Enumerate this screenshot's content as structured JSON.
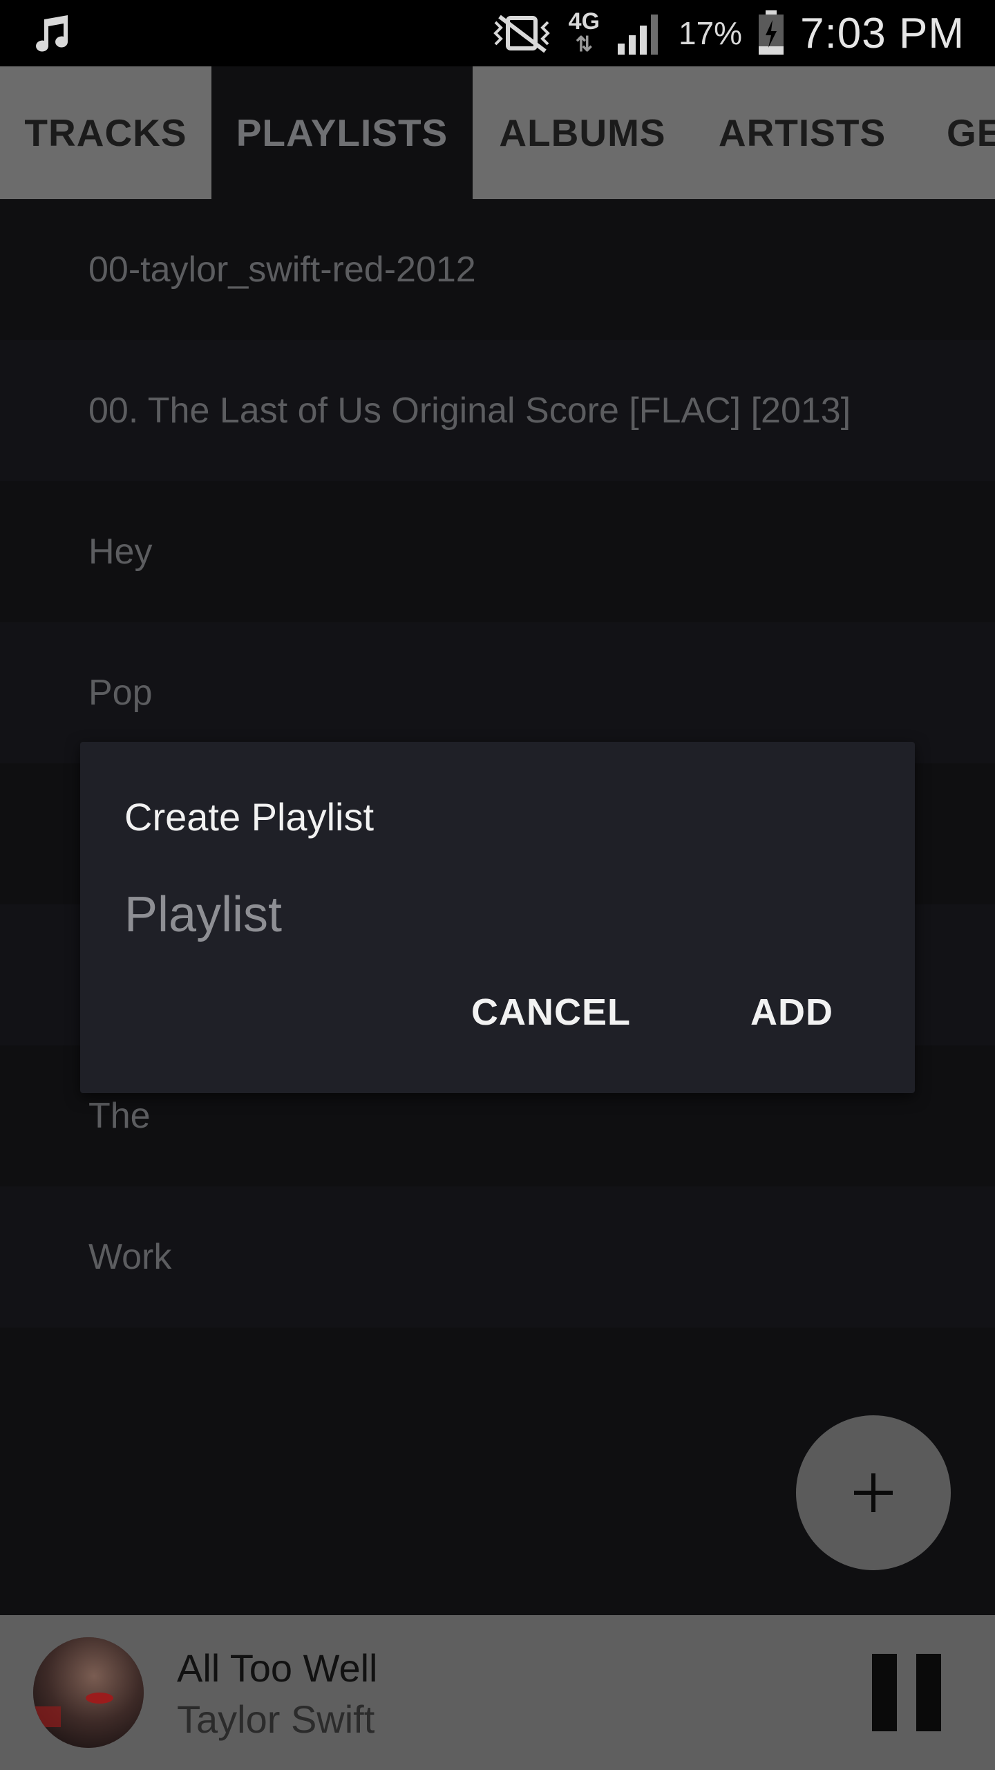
{
  "status_bar": {
    "network": "4G",
    "battery": "17%",
    "time": "7:03 PM",
    "icons": [
      "music-note-icon",
      "vibrate-mute-icon",
      "data-arrows-icon",
      "signal-icon",
      "battery-charging-icon"
    ]
  },
  "tabs": [
    {
      "label": "TRACKS",
      "active": false
    },
    {
      "label": "PLAYLISTS",
      "active": true
    },
    {
      "label": "ALBUMS",
      "active": false
    },
    {
      "label": "ARTISTS",
      "active": false
    },
    {
      "label": "GE",
      "active": false
    }
  ],
  "playlists": [
    "00-taylor_swift-red-2012",
    "00. The Last of Us Original Score [FLAC] [2013]",
    "Hey",
    "Pop",
    "",
    "",
    "The",
    "Work"
  ],
  "dialog": {
    "title": "Create Playlist",
    "input_placeholder": "Playlist",
    "cancel_label": "CANCEL",
    "add_label": "ADD"
  },
  "fab": {
    "icon": "plus-icon"
  },
  "now_playing": {
    "title": "All Too Well",
    "artist": "Taylor Swift",
    "icon": "pause-icon"
  },
  "colors": {
    "background": "#0f0f11",
    "tab_bar": "#6c6c6c",
    "dialog": "#1f2027",
    "now_playing_bar": "#5f5f5f"
  }
}
